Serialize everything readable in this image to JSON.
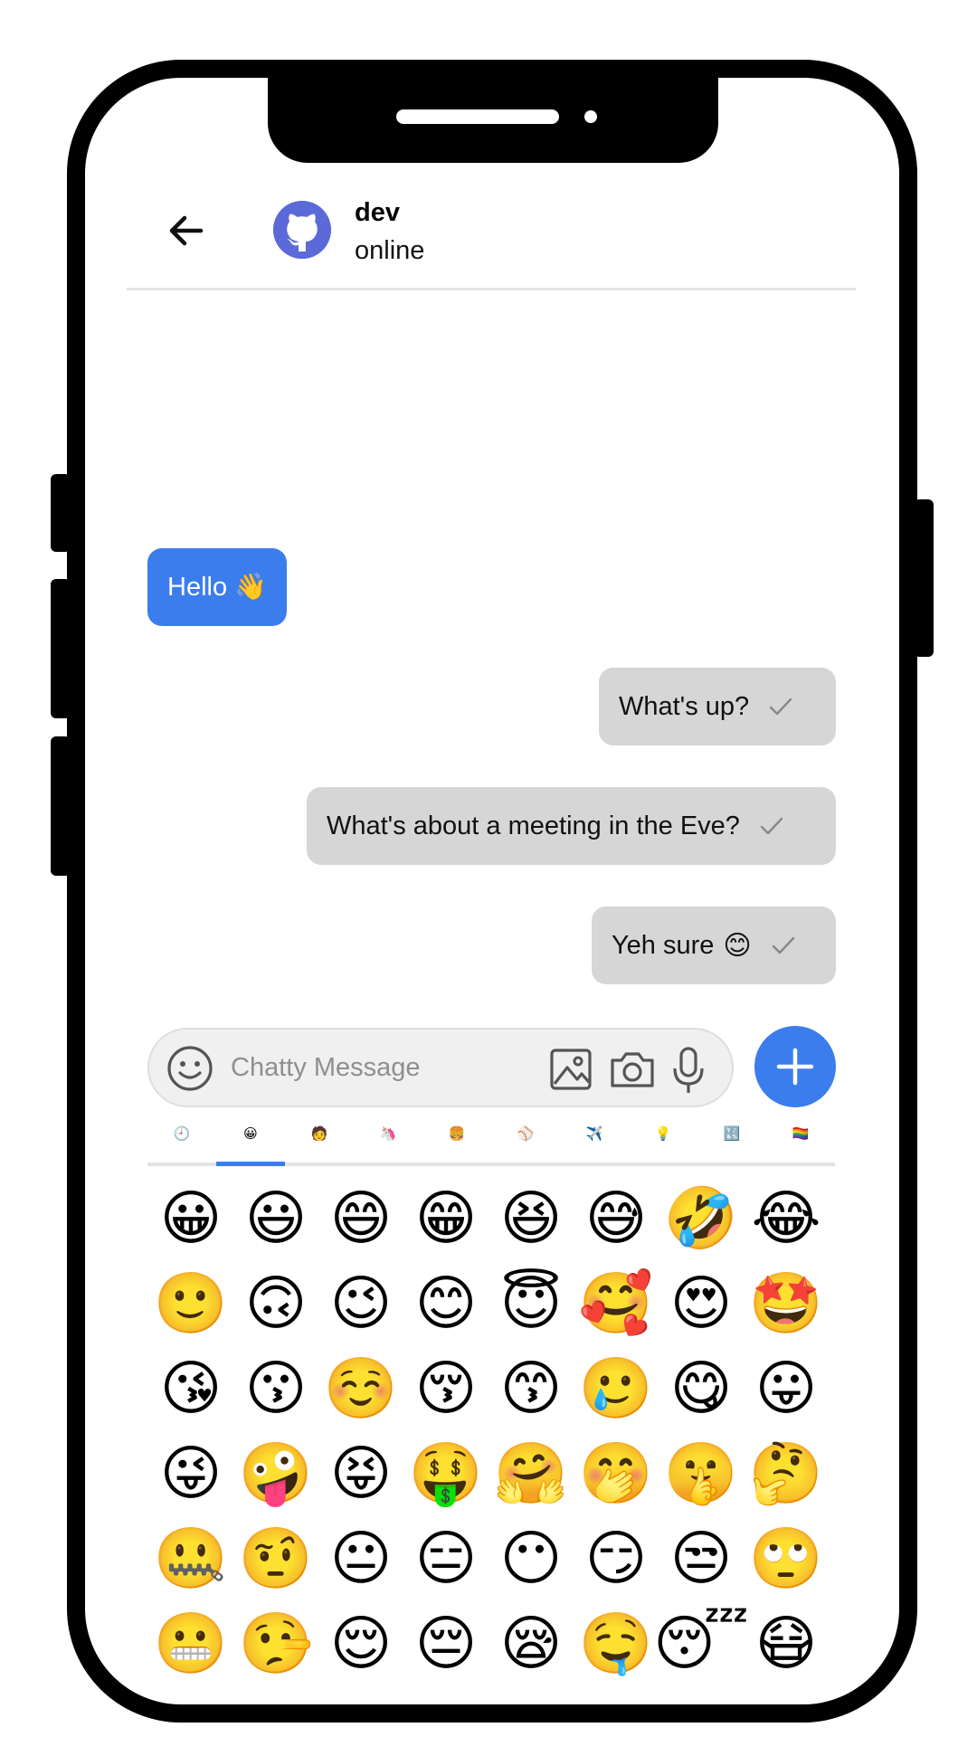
{
  "header": {
    "name": "dev",
    "status": "online",
    "back_icon": "arrow-left-icon",
    "avatar_icon": "github-octocat-icon"
  },
  "messages": [
    {
      "text": "Hello 👋",
      "direction": "incoming"
    },
    {
      "text": "What's up?",
      "direction": "outgoing",
      "status": "sent"
    },
    {
      "text": "What's about a meeting in the Eve?",
      "direction": "outgoing",
      "status": "sent"
    },
    {
      "text": "Yeh sure",
      "emoji": "😊",
      "direction": "outgoing",
      "status": "sent"
    }
  ],
  "input": {
    "placeholder": "Chatty Message",
    "icons": [
      "smiley-icon",
      "image-icon",
      "camera-icon",
      "microphone-icon"
    ]
  },
  "fab": {
    "icon": "plus-icon"
  },
  "emoji_categories": [
    {
      "name": "recent",
      "glyph": "🕘"
    },
    {
      "name": "smileys",
      "glyph": "😀"
    },
    {
      "name": "people",
      "glyph": "🧑"
    },
    {
      "name": "animals",
      "glyph": "🦄"
    },
    {
      "name": "food",
      "glyph": "🍔"
    },
    {
      "name": "activities",
      "glyph": "⚾"
    },
    {
      "name": "travel",
      "glyph": "✈️"
    },
    {
      "name": "objects",
      "glyph": "💡"
    },
    {
      "name": "symbols",
      "glyph": "🔣"
    },
    {
      "name": "flags",
      "glyph": "🏳️‍🌈"
    }
  ],
  "active_category": "smileys",
  "emojis": [
    "😀",
    "😃",
    "😄",
    "😁",
    "😆",
    "😅",
    "🤣",
    "😂",
    "🙂",
    "🙃",
    "😉",
    "😊",
    "😇",
    "🥰",
    "😍",
    "🤩",
    "😘",
    "😗",
    "☺️",
    "😚",
    "😙",
    "🥲",
    "😋",
    "😛",
    "😜",
    "🤪",
    "😝",
    "🤑",
    "🤗",
    "🤭",
    "🤫",
    "🤔",
    "🤐",
    "🤨",
    "😐",
    "😑",
    "😶",
    "😏",
    "😒",
    "🙄",
    "😬",
    "🤥",
    "😌",
    "😔",
    "😪",
    "🤤",
    "😴",
    "😷"
  ],
  "colors": {
    "accent": "#3b7ded",
    "outgoing_bubble": "#d6d6d6",
    "avatar": "#5b6ad8",
    "frame": "#000000"
  }
}
